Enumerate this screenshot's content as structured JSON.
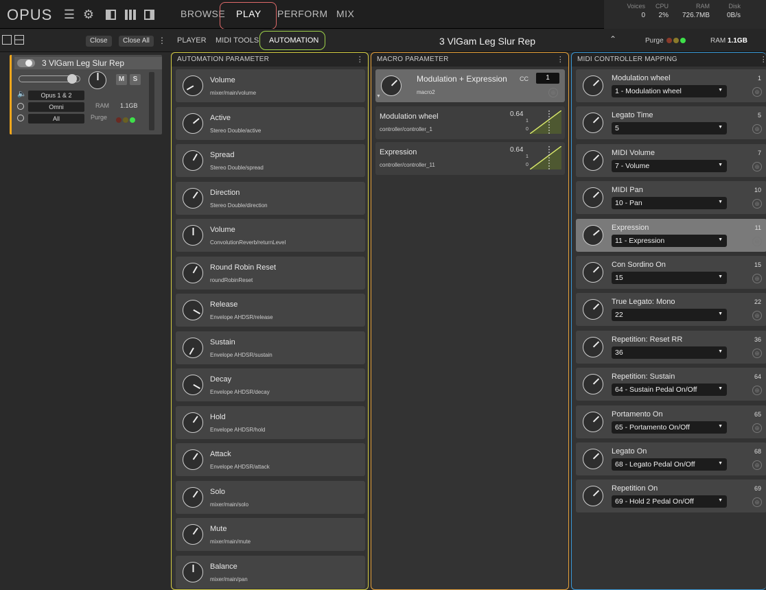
{
  "app": {
    "logo": "OPUS",
    "nav": [
      "BROWSE",
      "PLAY",
      "PERFORM",
      "MIX"
    ],
    "active_nav": "PLAY"
  },
  "stats": {
    "voices_label": "Voices",
    "voices": "0",
    "cpu_label": "CPU",
    "cpu": "2%",
    "ram_label": "RAM",
    "ram": "726.7MB",
    "disk_label": "Disk",
    "disk": "0B/s"
  },
  "subbar": {
    "close": "Close",
    "close_all": "Close All",
    "tabs": [
      "PLAYER",
      "MIDI TOOLS",
      "AUTOMATION"
    ],
    "instrument": "3 VlGam Leg Slur Rep",
    "purge": "Purge",
    "ram_label": "RAM",
    "ram": "1.1GB"
  },
  "instrument_card": {
    "name": "3 VlGam Leg Slur Rep",
    "m": "M",
    "s": "S",
    "output": "Opus 1 & 2",
    "midi_in": "Omni",
    "channel": "All",
    "ram_label": "RAM",
    "ram": "1.1GB",
    "purge": "Purge"
  },
  "automation": {
    "header": "AUTOMATION PARAMETER",
    "items": [
      {
        "title": "Volume",
        "path": "mixer/main/volume"
      },
      {
        "title": "Active",
        "path": "Stereo Double/active"
      },
      {
        "title": "Spread",
        "path": "Stereo Double/spread"
      },
      {
        "title": "Direction",
        "path": "Stereo Double/direction"
      },
      {
        "title": "Volume",
        "path": "ConvolutionReverb/returnLevel"
      },
      {
        "title": "Round Robin Reset",
        "path": "roundRobinReset"
      },
      {
        "title": "Release",
        "path": "Envelope AHDSR/release"
      },
      {
        "title": "Sustain",
        "path": "Envelope AHDSR/sustain"
      },
      {
        "title": "Decay",
        "path": "Envelope AHDSR/decay"
      },
      {
        "title": "Hold",
        "path": "Envelope AHDSR/hold"
      },
      {
        "title": "Attack",
        "path": "Envelope AHDSR/attack"
      },
      {
        "title": "Solo",
        "path": "mixer/main/solo"
      },
      {
        "title": "Mute",
        "path": "mixer/main/mute"
      },
      {
        "title": "Balance",
        "path": "mixer/main/pan"
      }
    ]
  },
  "macro": {
    "header": "MACRO PARAMETER",
    "title": "Modulation + Expression",
    "sub": "macro2",
    "cc_label": "CC",
    "cc": "1",
    "items": [
      {
        "title": "Modulation wheel",
        "path": "controller/controller_1",
        "value": "0.64",
        "one": "1",
        "zero": "0"
      },
      {
        "title": "Expression",
        "path": "controller/controller_11",
        "value": "0.64",
        "one": "1",
        "zero": "0"
      }
    ]
  },
  "midi": {
    "header": "MIDI CONTROLLER MAPPING",
    "items": [
      {
        "title": "Modulation wheel",
        "num": "1",
        "sel": "1 - Modulation wheel"
      },
      {
        "title": "Legato Time",
        "num": "5",
        "sel": "5"
      },
      {
        "title": "MIDI Volume",
        "num": "7",
        "sel": "7 - Volume"
      },
      {
        "title": "MIDI Pan",
        "num": "10",
        "sel": "10 - Pan"
      },
      {
        "title": "Expression",
        "num": "11",
        "sel": "11 - Expression"
      },
      {
        "title": "Con Sordino On",
        "num": "15",
        "sel": "15"
      },
      {
        "title": "True Legato: Mono",
        "num": "22",
        "sel": "22"
      },
      {
        "title": "Repetition: Reset RR",
        "num": "36",
        "sel": "36"
      },
      {
        "title": "Repetition: Sustain",
        "num": "64",
        "sel": "64 - Sustain Pedal On/Off"
      },
      {
        "title": "Portamento On",
        "num": "65",
        "sel": "65 - Portamento On/Off"
      },
      {
        "title": "Legato On",
        "num": "68",
        "sel": "68 - Legato Pedal On/Off"
      },
      {
        "title": "Repetition On",
        "num": "69",
        "sel": "69 - Hold 2 Pedal On/Off"
      }
    ]
  }
}
